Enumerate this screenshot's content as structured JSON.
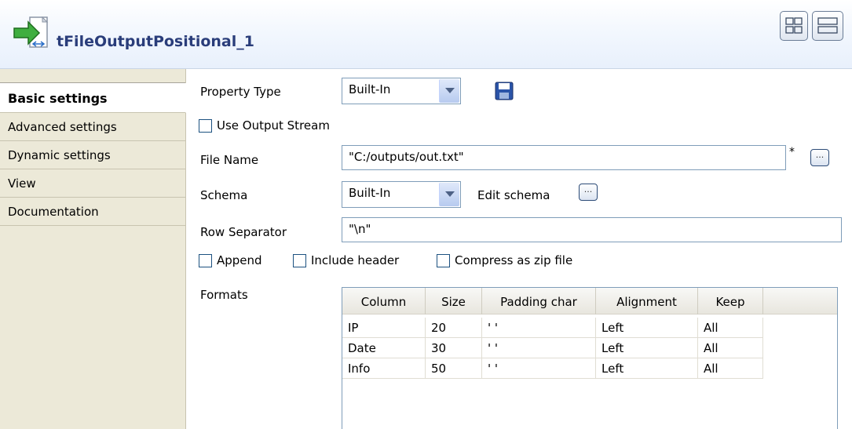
{
  "header": {
    "title": "tFileOutputPositional_1",
    "component_icon": "file-output-arrow-icon",
    "layout_buttons": [
      "grid-layout-icon",
      "rows-layout-icon"
    ]
  },
  "sidebar": {
    "items": [
      {
        "label": "Basic settings",
        "active": true
      },
      {
        "label": "Advanced settings",
        "active": false
      },
      {
        "label": "Dynamic settings",
        "active": false
      },
      {
        "label": "View",
        "active": false
      },
      {
        "label": "Documentation",
        "active": false
      }
    ]
  },
  "form": {
    "property_type": {
      "label": "Property Type",
      "value": "Built-In",
      "icon": "save-floppy-icon"
    },
    "use_output_stream": {
      "label": "Use Output Stream",
      "checked": false
    },
    "file_name": {
      "label": "File Name",
      "value": "\"C:/outputs/out.txt\"",
      "required_mark": "*",
      "browse": "..."
    },
    "schema": {
      "label": "Schema",
      "value": "Built-In",
      "edit_label": "Edit schema",
      "edit_button": "..."
    },
    "row_separator": {
      "label": "Row Separator",
      "value": "\"\\n\""
    },
    "append": {
      "label": "Append",
      "checked": false
    },
    "include_header": {
      "label": "Include header",
      "checked": false
    },
    "compress": {
      "label": "Compress as zip file",
      "checked": false
    },
    "formats_label": "Formats"
  },
  "formats_table": {
    "columns": [
      "Column",
      "Size",
      "Padding char",
      "Alignment",
      "Keep"
    ],
    "rows": [
      [
        "IP",
        "20",
        "' '",
        "Left",
        "All"
      ],
      [
        "Date",
        "30",
        "' '",
        "Left",
        "All"
      ],
      [
        "Info",
        "50",
        "' '",
        "Left",
        "All"
      ]
    ]
  },
  "colors": {
    "title_text": "#2a3d7a",
    "sidebar_bg": "#ece9d8",
    "field_border": "#7f9db9"
  }
}
